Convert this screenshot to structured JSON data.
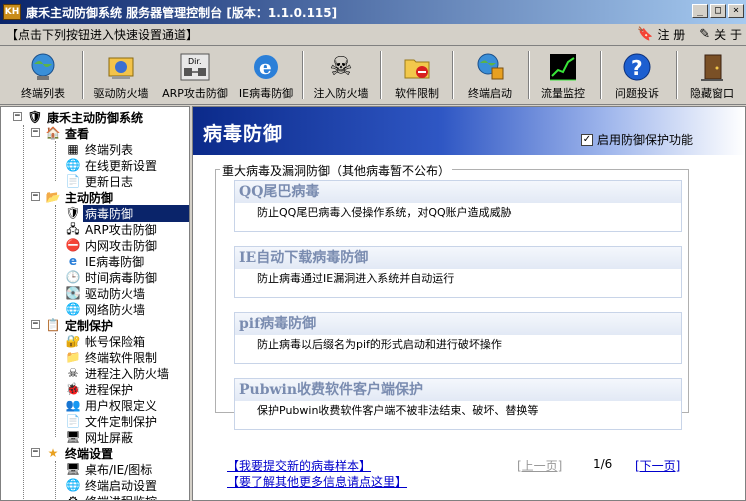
{
  "window": {
    "icon_text": "KH",
    "title": "康禾主动防御系统  服务器管理控制台 [版本：1.1.0.115]",
    "minimize_glyph": "_",
    "maximize_glyph": "□",
    "close_glyph": "×"
  },
  "quickbar": {
    "hint": "【点击下列按钮进入快速设置通道】",
    "register_label": "注 册",
    "about_label": "关 于"
  },
  "toolbar": [
    {
      "label": "终端列表",
      "icon": "terminal-globe-icon"
    },
    {
      "label": "驱动防火墙",
      "icon": "driver-firewall-icon"
    },
    {
      "label": "ARP攻击防御",
      "icon": "arp-dir-icon",
      "icon_text": "Dir."
    },
    {
      "label": "IE病毒防御",
      "icon": "ie-icon"
    },
    {
      "label": "注入防火墙",
      "icon": "skull-icon"
    },
    {
      "label": "软件限制",
      "icon": "software-restrict-icon"
    },
    {
      "label": "终端启动",
      "icon": "terminal-startup-icon"
    },
    {
      "label": "流量监控",
      "icon": "traffic-chart-icon"
    },
    {
      "label": "问题投诉",
      "icon": "question-icon"
    },
    {
      "label": "隐藏窗口",
      "icon": "door-icon"
    }
  ],
  "tree": {
    "root": "康禾主动防御系统",
    "groups": [
      {
        "label": "查看",
        "items": [
          "终端列表",
          "在线更新设置",
          "更新日志"
        ]
      },
      {
        "label": "主动防御",
        "items": [
          "病毒防御",
          "ARP攻击防御",
          "内网攻击防御",
          "IE病毒防御",
          "时间病毒防御",
          "驱动防火墙",
          "网络防火墙"
        ]
      },
      {
        "label": "定制保护",
        "items": [
          "帐号保险箱",
          "终端软件限制",
          "进程注入防火墙",
          "进程保护",
          "用户权限定义",
          "文件定制保护",
          "网址屏蔽"
        ]
      },
      {
        "label": "终端设置",
        "items": [
          "桌布/IE/图标",
          "终端启动设置",
          "终端进程监控"
        ]
      }
    ],
    "selected": "病毒防御"
  },
  "content": {
    "title": "病毒防御",
    "enable_label": "启用防御保护功能",
    "enable_checked": true,
    "group_title": "重大病毒及漏洞防御（其他病毒暂不公布）",
    "cards": [
      {
        "title": "QQ尾巴病毒",
        "desc": "防止QQ尾巴病毒入侵操作系统，对QQ账户造成威胁"
      },
      {
        "title": "IE自动下载病毒防御",
        "desc": "防止病毒通过IE漏洞进入系统并自动运行"
      },
      {
        "title": "pif病毒防御",
        "desc": "防止病毒以后缀名为pif的形式启动和进行破坏操作"
      },
      {
        "title": "Pubwin收费软件客户端保护",
        "desc": "保护Pubwin收费软件客户端不被非法结束、破坏、替换等"
      }
    ],
    "submit_link": "【我要提交新的病毒样本】",
    "more_link": "【要了解其他更多信息请点这里】",
    "prev_label": "[上一页]",
    "page_indicator": "1/6",
    "next_label": "[下一页]"
  },
  "colors": {
    "title_bar": "#0a246a",
    "selection": "#0a246a",
    "header_gradient_start": "#0b2a8a",
    "link": "#0000cc"
  }
}
